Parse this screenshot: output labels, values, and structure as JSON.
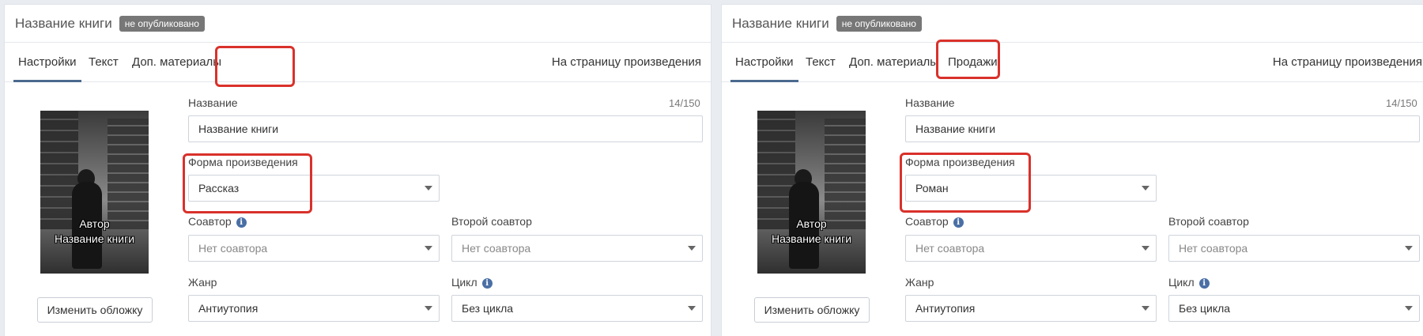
{
  "panels": [
    {
      "id": "left",
      "header": {
        "title": "Название книги",
        "badge": "не опубликовано"
      },
      "tabs": [
        {
          "label": "Настройки",
          "active": true
        },
        {
          "label": "Текст",
          "active": false
        },
        {
          "label": "Доп. материалы",
          "active": false
        }
      ],
      "tab_sales": "",
      "tab_right": "На страницу произведения",
      "cover": {
        "author": "Автор",
        "title": "Название книги",
        "button": "Изменить обложку"
      },
      "form": {
        "name_label": "Название",
        "name_counter": "14/150",
        "name_value": "Название книги",
        "form_label": "Форма произведения",
        "form_value": "Рассказ",
        "coauthor_label": "Соавтор",
        "coauthor_value": "Нет соавтора",
        "second_coauthor_label": "Второй соавтор",
        "second_coauthor_value": "Нет соавтора",
        "genre_label": "Жанр",
        "genre_value": "Антиутопия",
        "cycle_label": "Цикл",
        "cycle_value": "Без цикла"
      }
    },
    {
      "id": "right",
      "header": {
        "title": "Название книги",
        "badge": "не опубликовано"
      },
      "tabs": [
        {
          "label": "Настройки",
          "active": true
        },
        {
          "label": "Текст",
          "active": false
        },
        {
          "label": "Доп. материалы",
          "active": false
        }
      ],
      "tab_sales": "Продажи",
      "tab_right": "На страницу произведения",
      "cover": {
        "author": "Автор",
        "title": "Название книги",
        "button": "Изменить обложку"
      },
      "form": {
        "name_label": "Название",
        "name_counter": "14/150",
        "name_value": "Название книги",
        "form_label": "Форма произведения",
        "form_value": "Роман",
        "coauthor_label": "Соавтор",
        "coauthor_value": "Нет соавтора",
        "second_coauthor_label": "Второй соавтор",
        "second_coauthor_value": "Нет соавтора",
        "genre_label": "Жанр",
        "genre_value": "Антиутопия",
        "cycle_label": "Цикл",
        "cycle_value": "Без цикла"
      }
    }
  ],
  "icons": {
    "info": "info-icon",
    "caret": "chevron-down-icon"
  },
  "colors": {
    "highlight": "#d9312b",
    "active_tab": "#4c6a8e",
    "badge": "#777777",
    "info": "#4a6fa5"
  }
}
